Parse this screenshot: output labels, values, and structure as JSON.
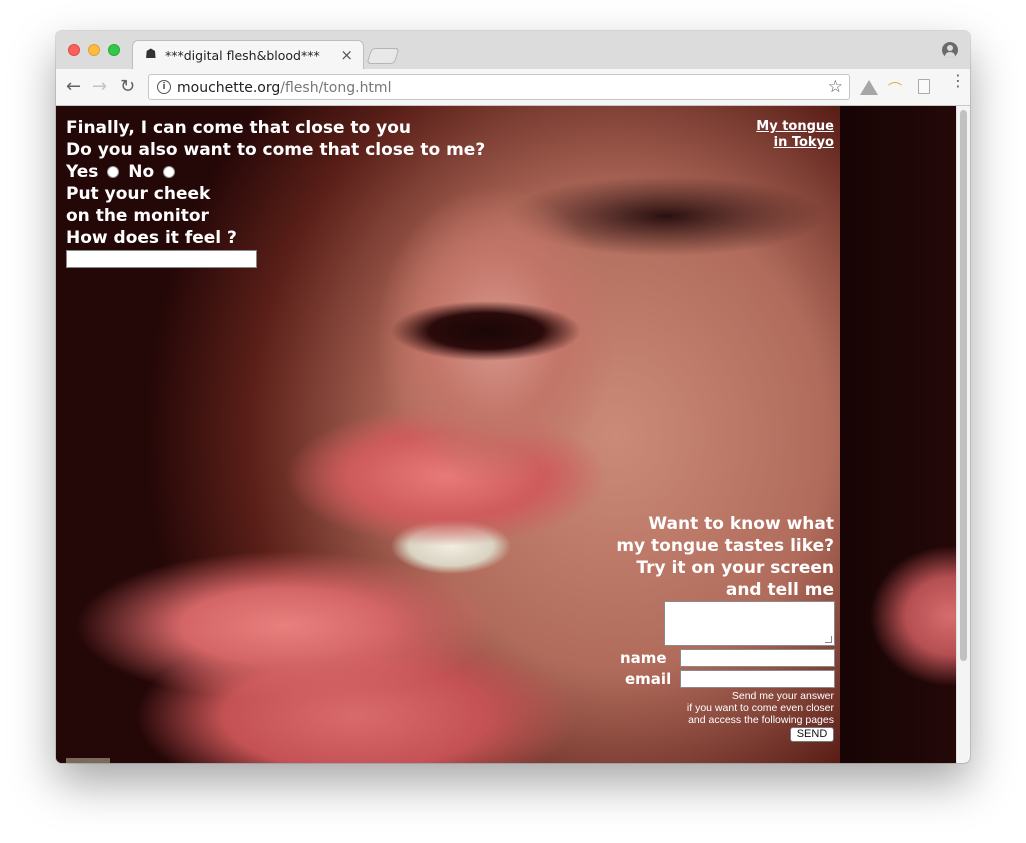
{
  "browser": {
    "tab_title": "***digital flesh&blood***",
    "tab_favicon": "figure-icon",
    "close_glyph": "×",
    "url_domain": "mouchette.org",
    "url_path": "/flesh/tong.html",
    "back_glyph": "←",
    "forward_glyph": "→",
    "reload_glyph": "↻",
    "info_glyph": "i",
    "star_glyph": "☆",
    "menu_glyph": "⋮"
  },
  "page": {
    "intro_lines": [
      "Finally, I can come that close to you",
      "Do you also want to come that close to me?"
    ],
    "yes_label": "Yes",
    "no_label": "No",
    "cheek_lines": [
      "Put your cheek",
      "on the monitor",
      "How does it feel ?"
    ],
    "top_link_1": "My tongue",
    "top_link_2": "in Tokyo",
    "taste_lines": [
      "Want to know what",
      "my tongue tastes like?",
      "Try it on your screen",
      "and tell me"
    ],
    "name_label": "name",
    "email_label": "email",
    "note_lines": [
      "Send me your answer",
      "if you want to come even closer",
      "and access the following pages"
    ],
    "send_label": "SEND"
  }
}
